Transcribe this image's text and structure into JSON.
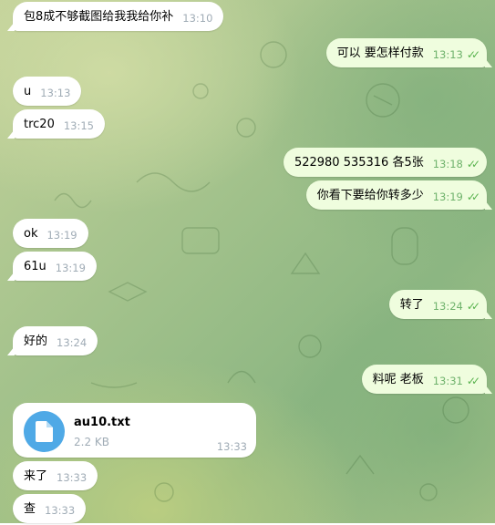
{
  "messages": [
    {
      "text": "包8成不够截图给我我给你补",
      "time": "13:10",
      "dir": "in"
    },
    {
      "text": "可以 要怎样付款",
      "time": "13:13",
      "dir": "out"
    },
    {
      "text": "u",
      "time": "13:13",
      "dir": "in"
    },
    {
      "text": "trc20",
      "time": "13:15",
      "dir": "in"
    },
    {
      "text": "522980  535316 各5张",
      "time": "13:18",
      "dir": "out"
    },
    {
      "text": "你看下要给你转多少",
      "time": "13:19",
      "dir": "out"
    },
    {
      "text": "ok",
      "time": "13:19",
      "dir": "in"
    },
    {
      "text": "61u",
      "time": "13:19",
      "dir": "in"
    },
    {
      "text": "转了",
      "time": "13:24",
      "dir": "out"
    },
    {
      "text": "好的",
      "time": "13:24",
      "dir": "in"
    },
    {
      "text": "料呢 老板",
      "time": "13:31",
      "dir": "out"
    },
    {
      "text": "来了",
      "time": "13:33",
      "dir": "in"
    },
    {
      "text": "查",
      "time": "13:33",
      "dir": "in"
    }
  ],
  "file": {
    "name": "au10.txt",
    "size": "2.2 KB",
    "time": "13:33",
    "icon": "document-icon"
  },
  "read_receipt_icon": "double-check-icon",
  "colors": {
    "incoming_bubble": "#ffffff",
    "outgoing_bubble": "#effdde",
    "read_check": "#59b34e",
    "file_icon_bg": "#4fa9e6"
  }
}
